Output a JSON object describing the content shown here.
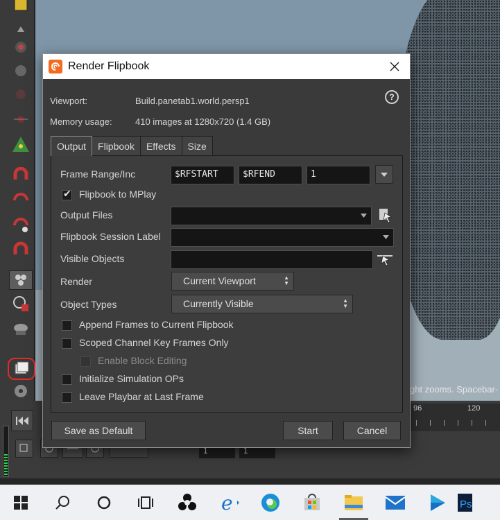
{
  "background": {
    "viewport_hint": "ght zooms. Spacebar-",
    "timeline": {
      "ticks": [
        "96",
        "120"
      ]
    },
    "timeline_fields": [
      "1",
      "1"
    ]
  },
  "dialog": {
    "title": "Render Flipbook",
    "help_label": "?",
    "viewport_label": "Viewport:",
    "viewport_value": "Build.panetab1.world.persp1",
    "memory_label": "Memory usage:",
    "memory_value": "410 images at 1280x720 (1.4 GB)",
    "tabs": [
      {
        "label": "Output",
        "active": true
      },
      {
        "label": "Flipbook",
        "active": false
      },
      {
        "label": "Effects",
        "active": false
      },
      {
        "label": "Size",
        "active": false
      }
    ],
    "frame_range": {
      "label": "Frame Range/Inc",
      "start": "$RFSTART",
      "end": "$RFEND",
      "inc": "1"
    },
    "flipbook_to_mplay": {
      "label": "Flipbook to MPlay",
      "checked": true
    },
    "output_files": {
      "label": "Output Files",
      "value": ""
    },
    "session_label": {
      "label": "Flipbook Session Label",
      "value": ""
    },
    "visible_objects": {
      "label": "Visible Objects",
      "value": ""
    },
    "render": {
      "label": "Render",
      "value": "Current Viewport"
    },
    "object_types": {
      "label": "Object Types",
      "value": "Currently Visible"
    },
    "checkboxes": [
      {
        "label": "Append Frames to Current Flipbook",
        "checked": false,
        "disabled": false
      },
      {
        "label": "Scoped Channel Key Frames Only",
        "checked": false,
        "disabled": false
      },
      {
        "label": "Enable Block Editing",
        "checked": false,
        "disabled": true
      },
      {
        "label": "Initialize Simulation OPs",
        "checked": false,
        "disabled": false
      },
      {
        "label": "Leave Playbar at Last Frame",
        "checked": false,
        "disabled": false
      }
    ],
    "buttons": {
      "save_default": "Save as Default",
      "start": "Start",
      "cancel": "Cancel"
    }
  },
  "colors": {
    "accent_red": "#e22b2b",
    "houdini_orange": "#f36b21",
    "taskbar": "#eef0f4"
  },
  "taskbar_icons": [
    "windows-start-icon",
    "search-icon",
    "cortana-icon",
    "task-view-icon",
    "chat-app-icon",
    "ie-icon",
    "edge-icon",
    "store-icon",
    "file-explorer-icon",
    "mail-icon",
    "movies-icon",
    "photoshop-icon"
  ]
}
